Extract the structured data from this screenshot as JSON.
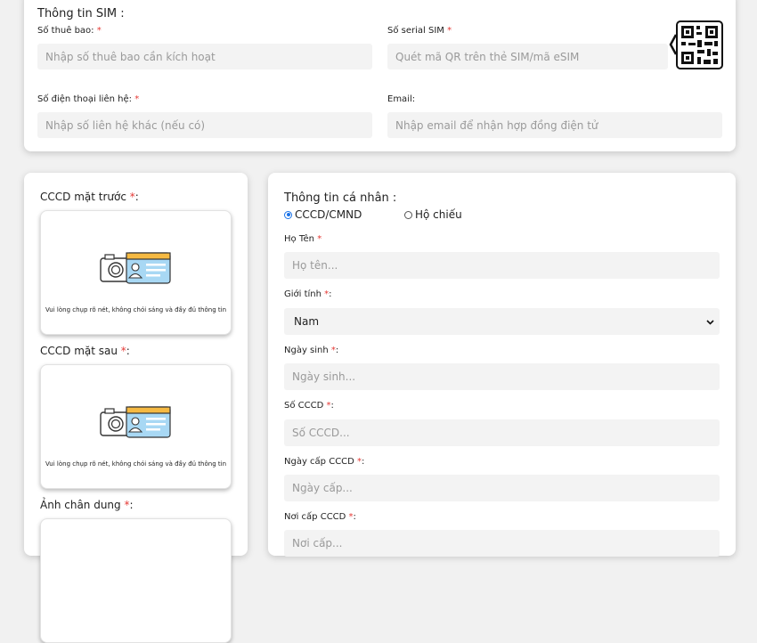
{
  "sim": {
    "title": "Thông tin SIM :",
    "subscriber": {
      "label": "Số thuê bao:",
      "required": "*",
      "placeholder": "Nhập số thuê bao cần kích hoạt"
    },
    "serial": {
      "label": "Số serial SIM",
      "required": "*",
      "placeholder": "Quét mã QR trên thẻ SIM/mã eSIM"
    },
    "contact_phone": {
      "label": "Số điện thoại liên hệ:",
      "required": "*",
      "placeholder": "Nhập số liên hệ khác (nếu có)"
    },
    "email": {
      "label": "Email:",
      "placeholder": "Nhập email để nhận hợp đồng điện tử"
    },
    "qr_icon": "qr-scan-icon"
  },
  "uploads": {
    "front": {
      "label": "CCCD mặt trước",
      "required": "*",
      "suffix": ":",
      "hint": "Vui lòng chụp rõ nét, không chói sáng và đầy đủ thông tin"
    },
    "back": {
      "label": "CCCD mặt sau",
      "required": "*",
      "suffix": ":",
      "hint": "Vui lòng chụp rõ nét, không chói sáng và đầy đủ thông tin"
    },
    "portrait": {
      "label": "Ảnh chân dung",
      "required": "*",
      "suffix": ":"
    },
    "illustration_icon": "camera-id-card-icon"
  },
  "personal": {
    "title": "Thông tin cá nhân :",
    "doc_type": {
      "options": [
        "CCCD/CMND",
        "Hộ chiếu"
      ],
      "selected": "CCCD/CMND"
    },
    "full_name": {
      "label": "Họ Tên",
      "required": "*",
      "placeholder": "Họ tên..."
    },
    "gender": {
      "label": "Giới tính",
      "required": "*",
      "suffix": ":",
      "value": "Nam"
    },
    "dob": {
      "label": "Ngày sinh",
      "required": "*",
      "suffix": ":",
      "placeholder": "Ngày sinh..."
    },
    "id_no": {
      "label": "Số CCCD",
      "required": "*",
      "suffix": ":",
      "placeholder": "Số CCCD..."
    },
    "issue_date": {
      "label": "Ngày cấp CCCD",
      "required": "*",
      "suffix": ":",
      "placeholder": "Ngày cấp..."
    },
    "issue_place": {
      "label": "Nơi cấp CCCD",
      "required": "*",
      "suffix": ":",
      "placeholder": "Nơi cấp..."
    }
  },
  "colors": {
    "required": "#e53935",
    "radio_selected": "#1a73e8",
    "illustration_blue": "#a8d8f4",
    "illustration_orange": "#f5b942"
  }
}
